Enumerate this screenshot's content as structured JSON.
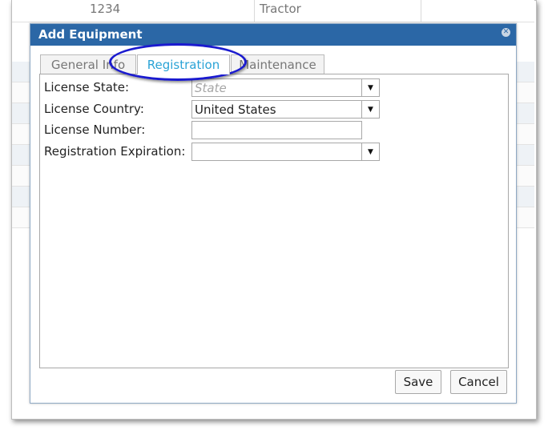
{
  "background": {
    "row_id": "1234",
    "row_type": "Tractor"
  },
  "dialog": {
    "title": "Add Equipment",
    "close_icon": "close-icon"
  },
  "tabs": [
    {
      "label": "General Info"
    },
    {
      "label": "Registration"
    },
    {
      "label": "Maintenance"
    }
  ],
  "form": {
    "license_state": {
      "label": "License State:",
      "placeholder": "State"
    },
    "license_country": {
      "label": "License Country:",
      "value": "United States"
    },
    "license_number": {
      "label": "License Number:",
      "value": ""
    },
    "registration_expiration": {
      "label": "Registration Expiration:",
      "value": ""
    }
  },
  "buttons": {
    "save": "Save",
    "cancel": "Cancel"
  },
  "colors": {
    "title_bar": "#2b67a6",
    "active_tab_text": "#2aa3d6",
    "annotation": "#1a1acf"
  }
}
